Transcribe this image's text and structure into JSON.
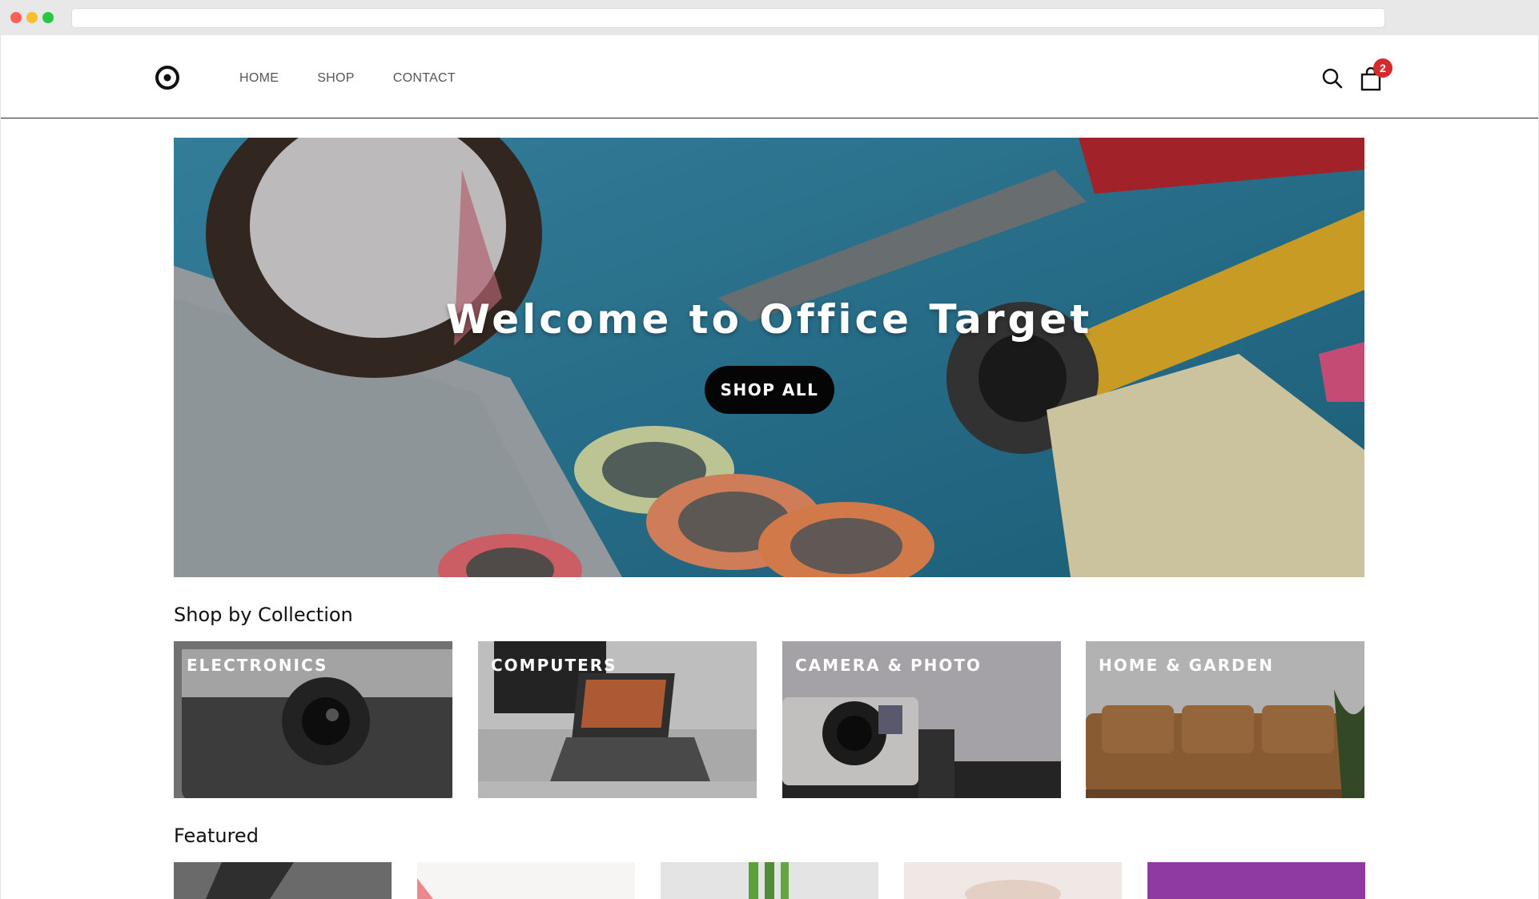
{
  "nav": {
    "items": [
      {
        "label": "HOME"
      },
      {
        "label": "SHOP"
      },
      {
        "label": "CONTACT"
      }
    ]
  },
  "cart": {
    "count": "2"
  },
  "hero": {
    "title": "Welcome to Office Target",
    "button_label": "SHOP ALL"
  },
  "collections": {
    "title": "Shop by Collection",
    "items": [
      {
        "label": "ELECTRONICS"
      },
      {
        "label": "COMPUTERS"
      },
      {
        "label": "CAMERA & PHOTO"
      },
      {
        "label": "HOME & GARDEN"
      }
    ]
  },
  "featured": {
    "title": "Featured"
  },
  "colors": {
    "badge": "#d52b2b",
    "button": "#050505",
    "hero_bg": "#2f7d9a"
  },
  "icons": [
    "logo-icon",
    "search-icon",
    "cart-icon"
  ]
}
